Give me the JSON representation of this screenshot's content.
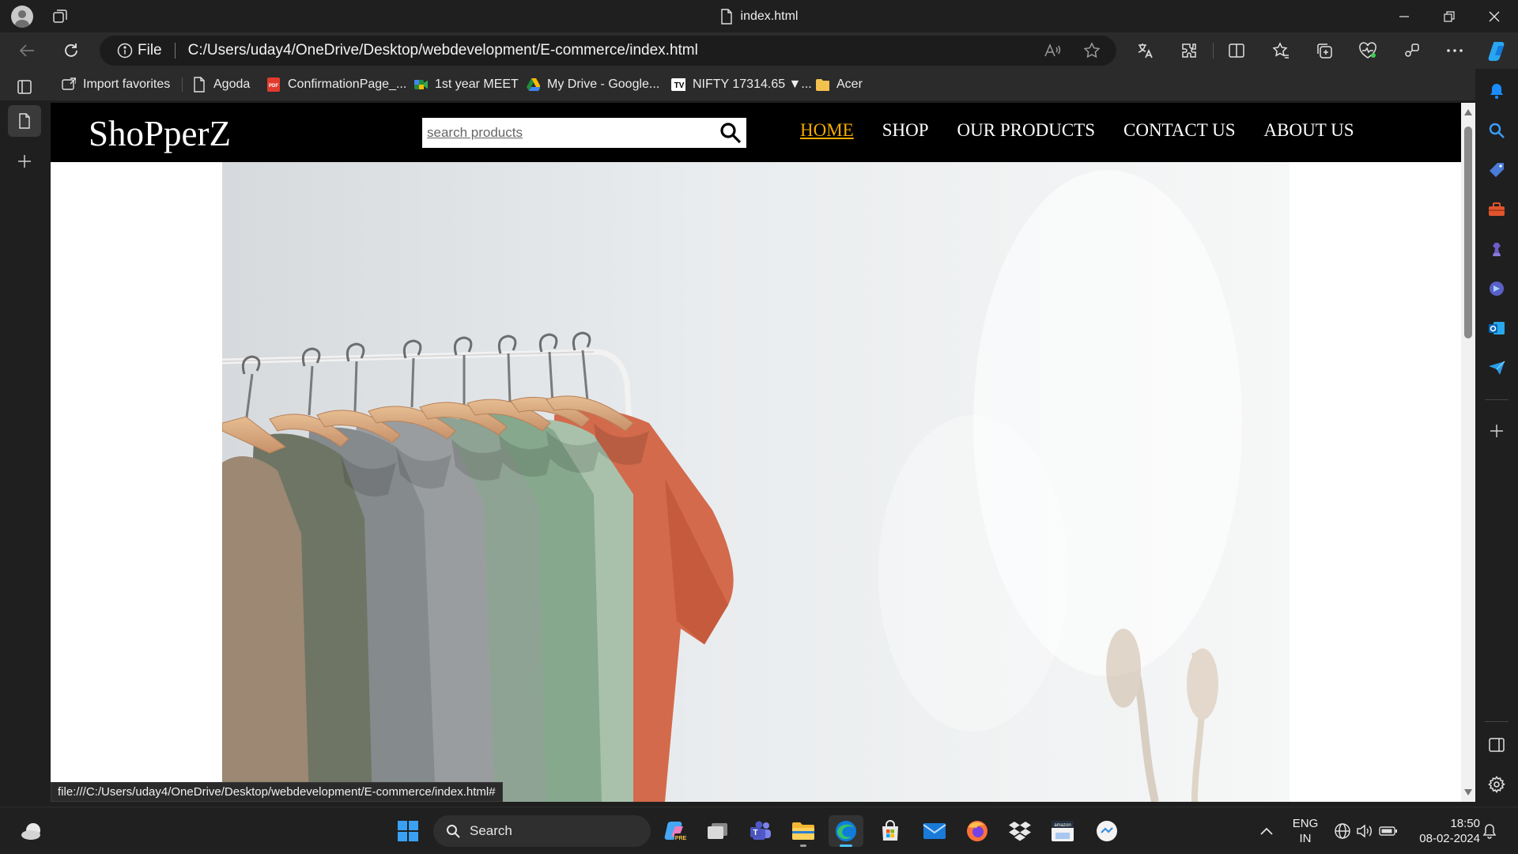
{
  "window": {
    "title": "index.html",
    "minimize_icon": "minimize-icon",
    "restore_icon": "restore-icon",
    "close_icon": "close-icon"
  },
  "addressbar": {
    "scheme_label": "File",
    "url": "C:/Users/uday4/OneDrive/Desktop/webdevelopment/E-commerce/index.html"
  },
  "favorites": [
    {
      "label": "Import favorites",
      "icon": "import-icon"
    },
    {
      "label": "Agoda",
      "icon": "page-icon"
    },
    {
      "label": "ConfirmationPage_...",
      "icon": "pdf-icon"
    },
    {
      "label": "1st year MEET",
      "icon": "meet-icon"
    },
    {
      "label": "My Drive - Google...",
      "icon": "drive-icon"
    },
    {
      "label": "NIFTY 17314.65 ▼...",
      "icon": "tradingview-icon"
    },
    {
      "label": "Acer",
      "icon": "folder-icon"
    }
  ],
  "site": {
    "logo": "ShoPperZ",
    "search_placeholder": "search products",
    "nav": [
      "HOME",
      "SHOP",
      "OUR PRODUCTS",
      "CONTACT US",
      "ABOUT US"
    ],
    "active_nav": "HOME",
    "accent_color": "#f2a900"
  },
  "status_url": "file:///C:/Users/uday4/OneDrive/Desktop/webdevelopment/E-commerce/index.html#",
  "taskbar": {
    "search_label": "Search",
    "language_line1": "ENG",
    "language_line2": "IN",
    "time": "18:50",
    "date": "08-02-2024"
  }
}
